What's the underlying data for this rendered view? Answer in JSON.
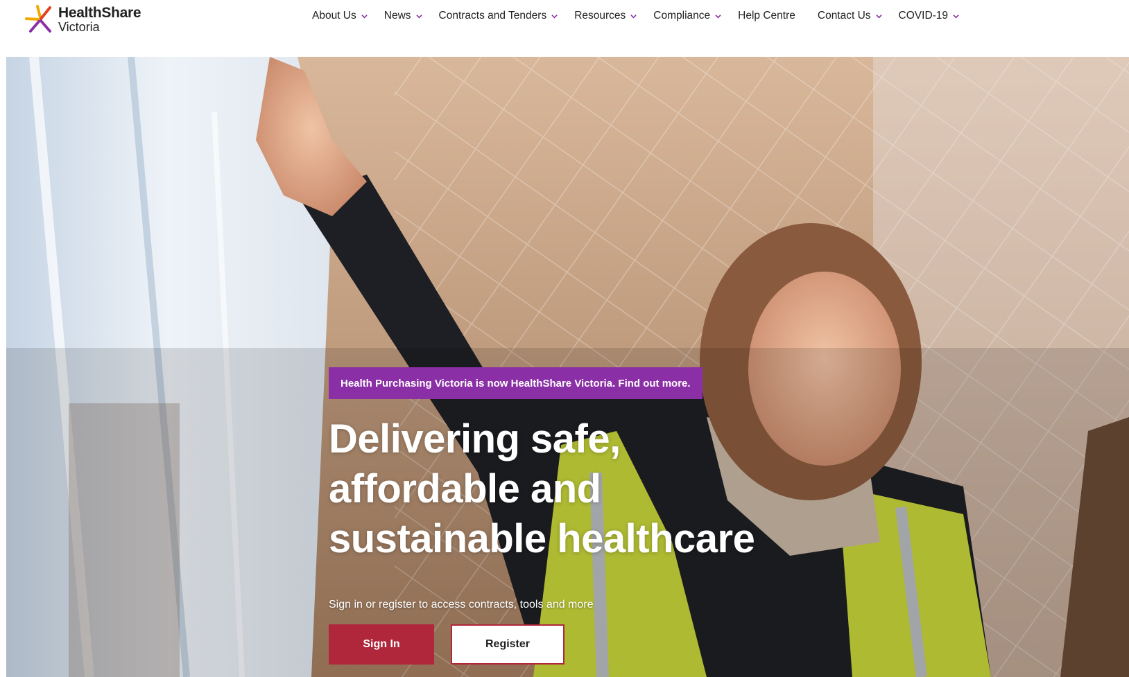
{
  "brand": {
    "name": "HealthShare",
    "sub": "Victoria",
    "colors": {
      "orange": "#f2a900",
      "purple": "#8b2fa6",
      "red": "#b0263a",
      "dark": "#3a1f5c"
    }
  },
  "nav": {
    "items": [
      {
        "label": "About Us",
        "has_dropdown": true
      },
      {
        "label": "News",
        "has_dropdown": true
      },
      {
        "label": "Contracts and Tenders",
        "has_dropdown": true
      },
      {
        "label": "Resources",
        "has_dropdown": true
      },
      {
        "label": "Compliance",
        "has_dropdown": true
      },
      {
        "label": "Help Centre",
        "has_dropdown": false
      },
      {
        "label": "Contact Us",
        "has_dropdown": true
      },
      {
        "label": "COVID-19",
        "has_dropdown": true
      }
    ],
    "chevron_icon": "chevron-down-icon"
  },
  "hero": {
    "announcement": "Health Purchasing Victoria is now HealthShare Victoria. Find out more.",
    "headline": [
      "Delivering safe,",
      "affordable and",
      "sustainable healthcare"
    ],
    "subtext": "Sign in or register to access contracts, tools and more",
    "signin_label": "Sign In",
    "register_label": "Register",
    "image": "warehouse-worker-photo"
  }
}
